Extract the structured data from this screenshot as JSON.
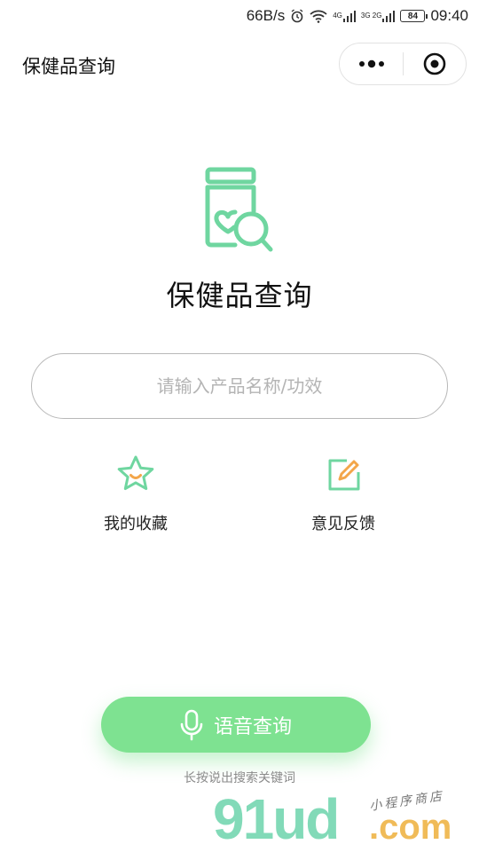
{
  "status_bar": {
    "speed": "66B/s",
    "network1_label": "4G",
    "network2_label": "3G 2G",
    "battery": "84",
    "time": "09:40"
  },
  "navbar": {
    "title": "保健品查询",
    "more_icon": "more-dots-icon",
    "close_icon": "target-close-icon"
  },
  "main": {
    "logo_icon": "jar-heart-search-icon",
    "title": "保健品查询",
    "search_placeholder": "请输入产品名称/功效",
    "search_value": "",
    "quick_actions": [
      {
        "label": "我的收藏",
        "icon": "star-icon"
      },
      {
        "label": "意见反馈",
        "icon": "edit-icon"
      }
    ]
  },
  "voice": {
    "label": "语音查询",
    "icon": "microphone-icon",
    "hint": "长按说出搜索关键词"
  },
  "watermark": {
    "main": "91ud",
    "domain": ".com",
    "sub": "小程序商店"
  },
  "colors": {
    "accent_green": "#7ee291",
    "icon_green": "#6fd6a0",
    "star_orange": "#f3a64a"
  }
}
